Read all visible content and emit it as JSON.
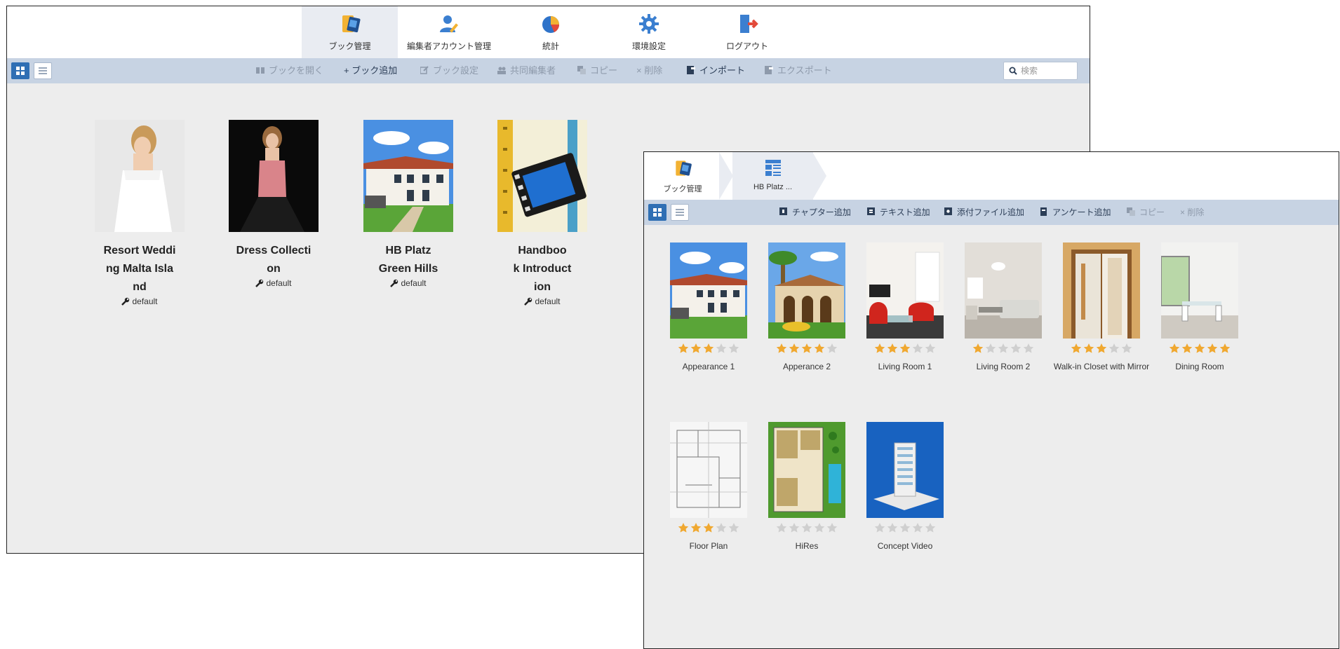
{
  "main_window": {
    "nav": [
      {
        "label": "ブック管理",
        "icon": "book-icon",
        "active": true
      },
      {
        "label": "編集者アカウント管理",
        "icon": "user-edit-icon",
        "active": false
      },
      {
        "label": "統計",
        "icon": "pie-chart-icon",
        "active": false
      },
      {
        "label": "環境設定",
        "icon": "gear-icon",
        "active": false
      },
      {
        "label": "ログアウト",
        "icon": "logout-icon",
        "active": false
      }
    ],
    "toolbar": [
      {
        "label": "ブックを開く",
        "icon": "book-open-icon",
        "enabled": false
      },
      {
        "label": "+ ブック追加",
        "icon": "",
        "enabled": true
      },
      {
        "label": "ブック設定",
        "icon": "edit-icon",
        "enabled": false
      },
      {
        "label": "共同編集者",
        "icon": "group-icon",
        "enabled": false
      },
      {
        "label": "コピー",
        "icon": "copy-icon",
        "enabled": false
      },
      {
        "label": "× 削除",
        "icon": "",
        "enabled": false
      },
      {
        "label": "インポート",
        "icon": "import-icon",
        "enabled": true
      },
      {
        "label": "エクスポート",
        "icon": "export-icon",
        "enabled": false
      }
    ],
    "search_placeholder": "検索",
    "books": [
      {
        "title_lines": [
          "Resort Weddi",
          "ng Malta Isla",
          "nd"
        ],
        "owner": "default"
      },
      {
        "title_lines": [
          "Dress Collecti",
          "on"
        ],
        "owner": "default"
      },
      {
        "title_lines": [
          "HB Platz",
          "Green Hills"
        ],
        "owner": "default"
      },
      {
        "title_lines": [
          "Handboo",
          "k Introduct",
          "ion"
        ],
        "owner": "default"
      }
    ]
  },
  "book_window": {
    "breadcrumb": [
      {
        "label": "ブック管理",
        "icon": "book-icon"
      },
      {
        "label": "HB Platz ...",
        "icon": "layout-icon"
      }
    ],
    "toolbar": [
      {
        "label": "チャプター追加",
        "icon": "chapter-icon",
        "enabled": true
      },
      {
        "label": "テキスト追加",
        "icon": "text-icon",
        "enabled": true
      },
      {
        "label": "添付ファイル追加",
        "icon": "attach-icon",
        "enabled": true
      },
      {
        "label": "アンケート追加",
        "icon": "survey-icon",
        "enabled": true
      },
      {
        "label": "コピー",
        "icon": "copy-icon",
        "enabled": false
      },
      {
        "label": "× 削除",
        "icon": "",
        "enabled": false
      }
    ],
    "chapters": [
      {
        "caption": "Appearance 1",
        "rating": 3
      },
      {
        "caption": "Apperance 2",
        "rating": 4
      },
      {
        "caption": "Living Room 1",
        "rating": 3
      },
      {
        "caption": "Living Room 2",
        "rating": 1
      },
      {
        "caption": "Walk-in Closet with Mirror",
        "rating": 3
      },
      {
        "caption": "Dining Room",
        "rating": 5
      },
      {
        "caption": "Floor Plan",
        "rating": 3
      },
      {
        "caption": "HiRes",
        "rating": 0
      },
      {
        "caption": "Concept Video",
        "rating": 0
      }
    ]
  },
  "colors": {
    "toolbar_bg": "#c7d3e3",
    "accent": "#2f6fb4",
    "star_on": "#f0a830",
    "star_off": "#cfcfcf"
  }
}
